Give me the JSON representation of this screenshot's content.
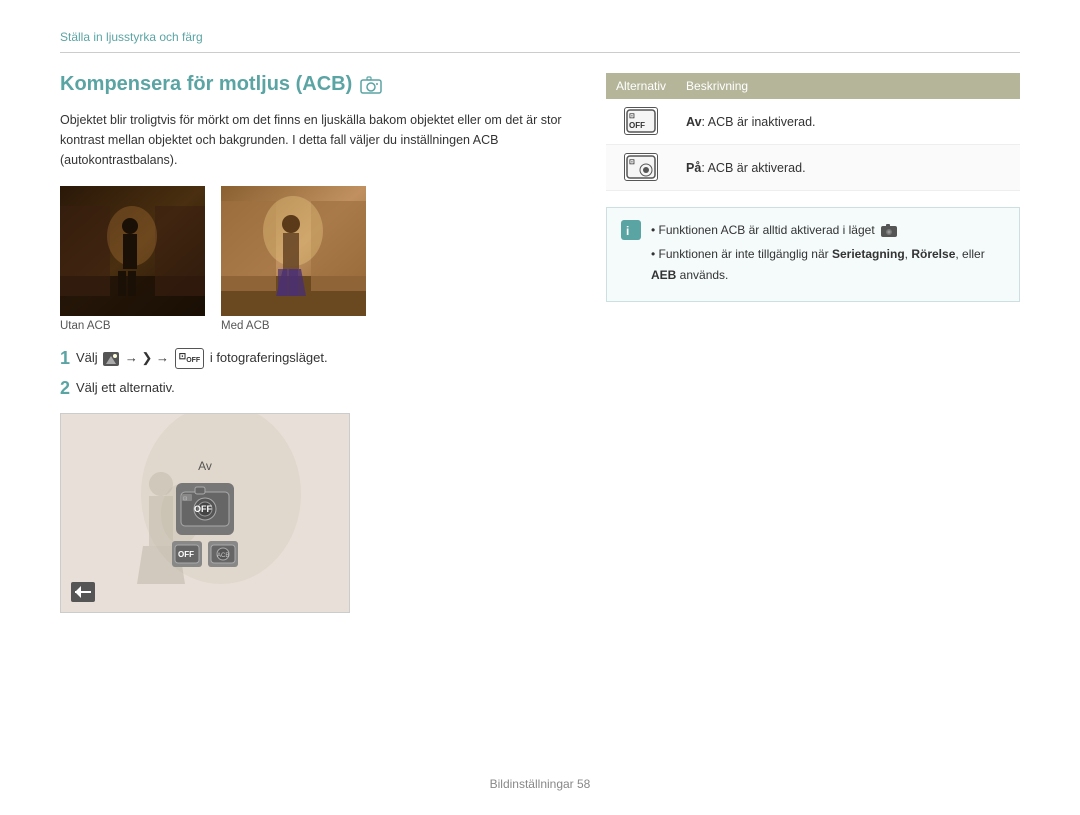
{
  "breadcrumb": "Ställa in ljusstyrka och färg",
  "title": "Kompensera för motljus (ACB)",
  "description": "Objektet blir troligtvis för mörkt om det finns en ljuskälla bakom objektet eller om det är stor kontrast mellan objektet och bakgrunden. I detta fall väljer du inställningen ACB (autokontrastbalans).",
  "photos": [
    {
      "label": "Utan ACB",
      "type": "dark"
    },
    {
      "label": "Med ACB",
      "type": "bright"
    }
  ],
  "step1": "Välj ",
  "step1_arrows": "→ ❯ → ",
  "step1_suffix": " i fotograferingsläget.",
  "step2": "Välj ett alternativ.",
  "table": {
    "col1": "Alternativ",
    "col2": "Beskrivning",
    "rows": [
      {
        "icon": "OFF",
        "label_bold": "Av",
        "label": ": ACB är inaktiverad."
      },
      {
        "icon": "ON",
        "label_bold": "På",
        "label": ": ACB är aktiverad."
      }
    ]
  },
  "notes": [
    "Funktionen ACB är alltid aktiverad i läget",
    "Funktionen är inte tillgänglig när Serietagning, Rörelse, eller AEB används."
  ],
  "note_bold_words": [
    "Serietagning,",
    "Rörelse,",
    "AEB"
  ],
  "preview": {
    "label": "Av",
    "large_icon": "COFF",
    "small_icons": [
      "off",
      "on"
    ]
  },
  "footer": "Bildinställningar  58"
}
